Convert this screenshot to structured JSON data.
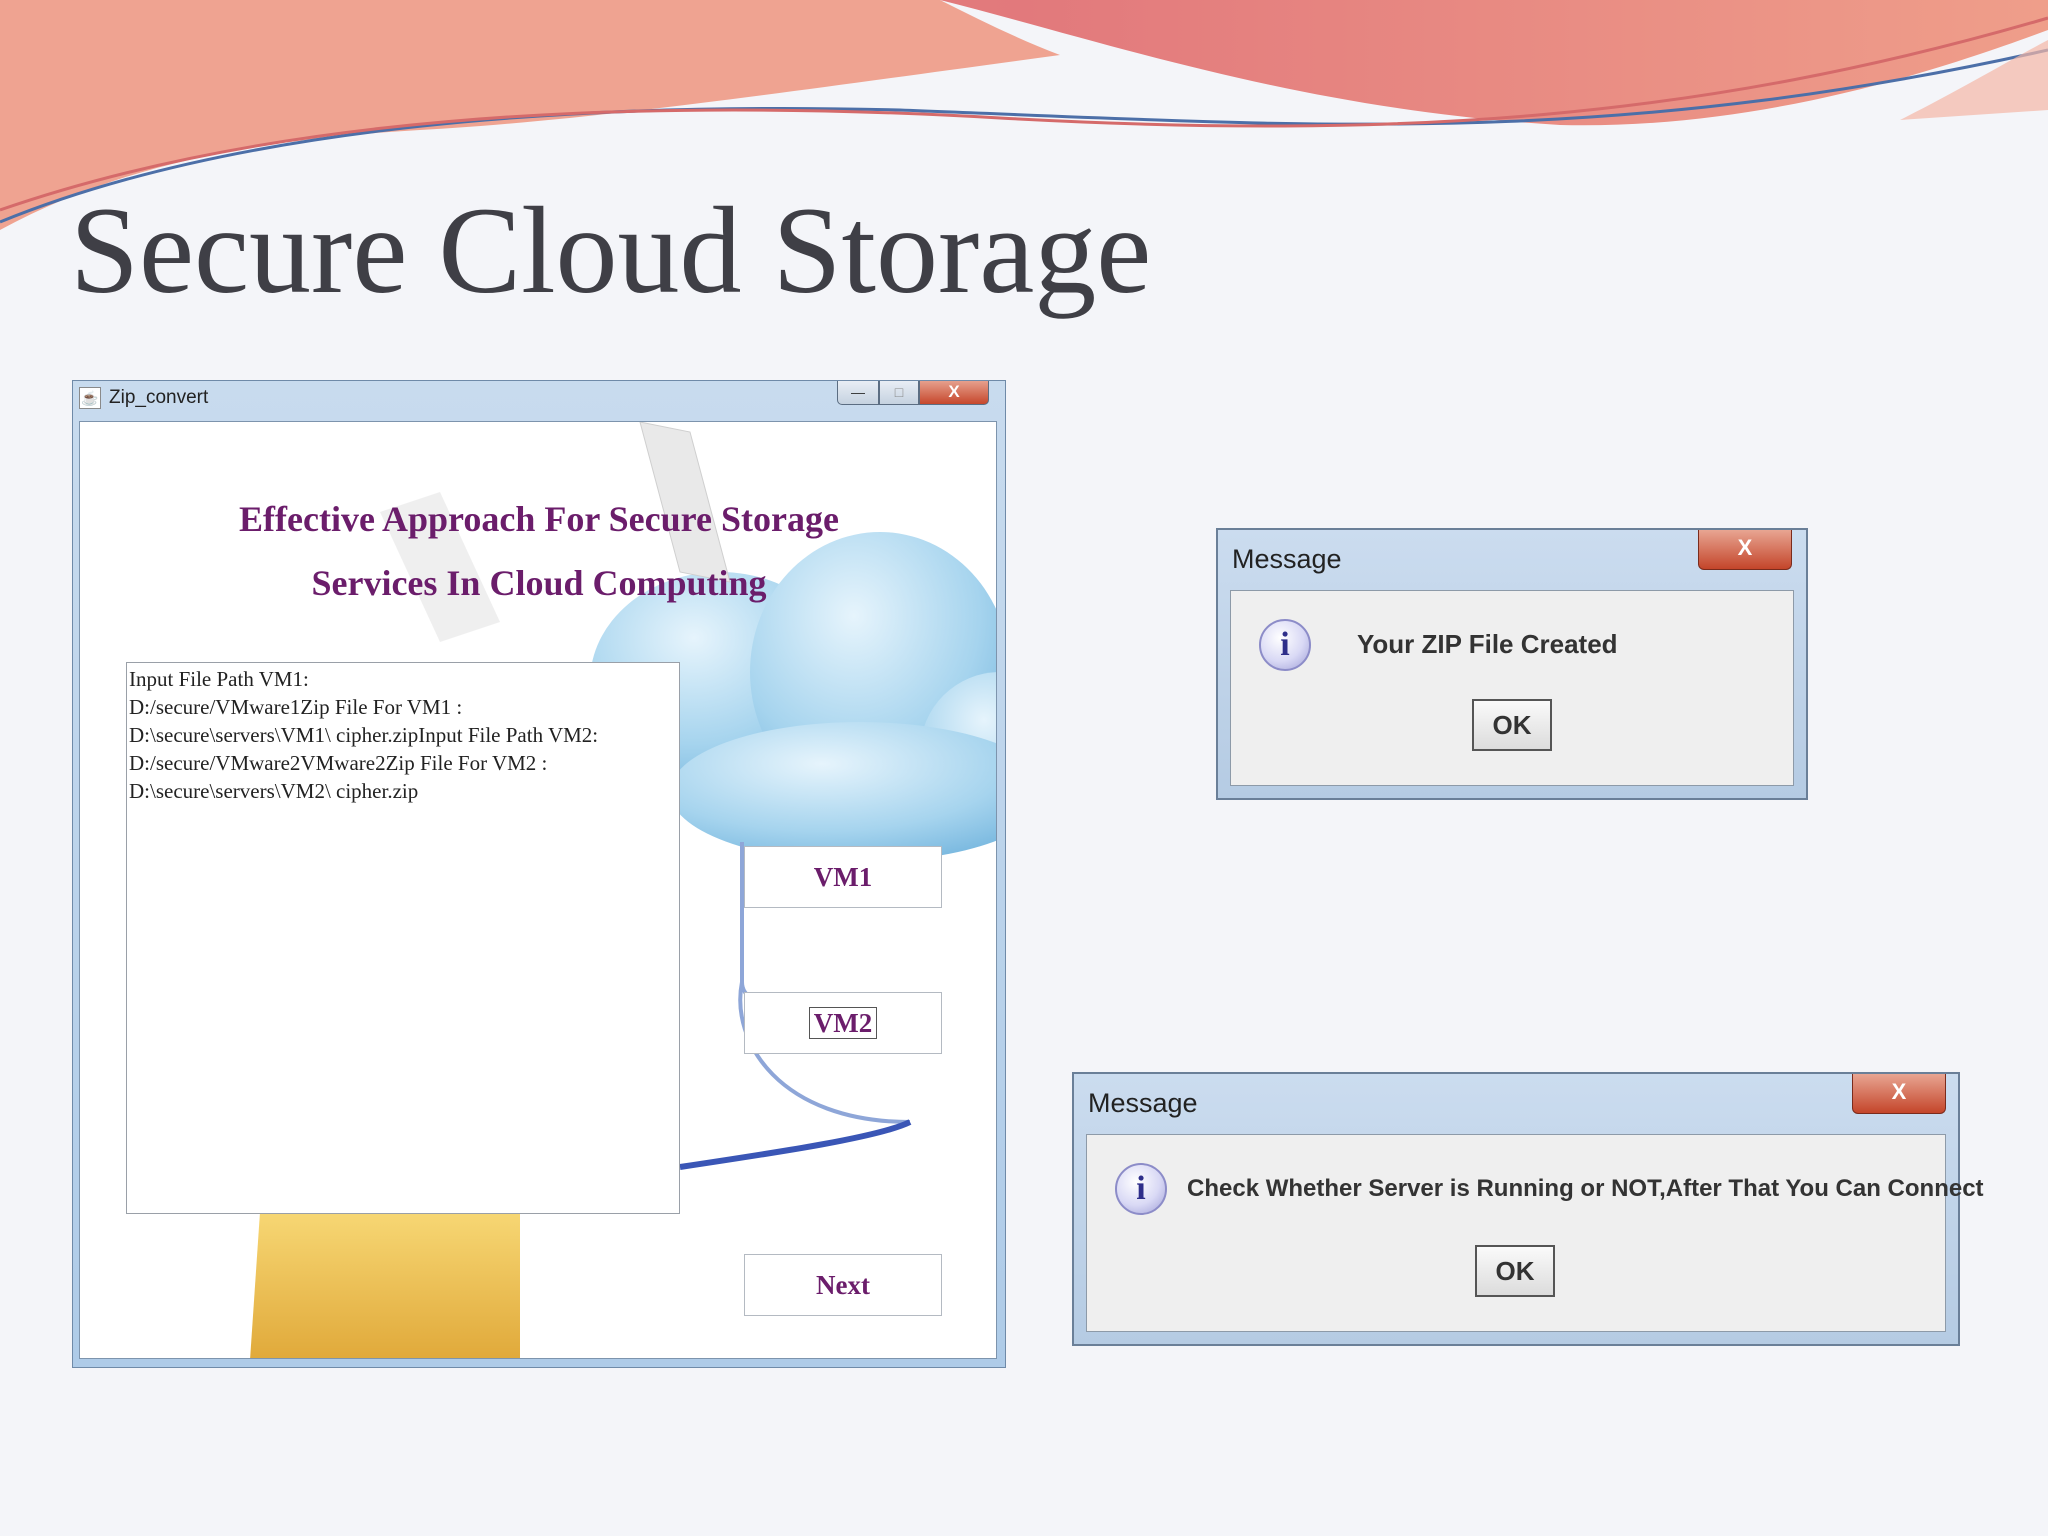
{
  "slide": {
    "title": "Secure Cloud Storage"
  },
  "app_window": {
    "title": "Zip_convert",
    "controls": {
      "minimize": "—",
      "maximize": "□",
      "close": "X"
    },
    "heading_line1": "Effective Approach For Secure Storage",
    "heading_line2": "Services  In Cloud Computing",
    "log_text": "Input File Path VM1:\nD:/secure/VMware1Zip File For VM1 :\nD:\\secure\\servers\\VM1\\ cipher.zipInput File Path VM2:\nD:/secure/VMware2VMware2Zip File For VM2 :\nD:\\secure\\servers\\VM2\\ cipher.zip",
    "buttons": {
      "vm1": "VM1",
      "vm2": "VM2",
      "next": "Next"
    }
  },
  "dialog_zip": {
    "title": "Message",
    "close": "X",
    "icon_glyph": "i",
    "message": "Your ZIP File Created",
    "ok": "OK"
  },
  "dialog_server": {
    "title": "Message",
    "close": "X",
    "icon_glyph": "i",
    "message": "Check Whether Server is Running or NOT,After That You Can Connect",
    "ok": "OK"
  },
  "colors": {
    "heading": "#6b1d6b",
    "title_text": "#3f3f46",
    "wave_primary": "#e8846f",
    "wave_light": "#f6c4b4",
    "cloud": "#8fc6e6"
  },
  "icons": {
    "app": "java-cup-icon",
    "info": "info-icon",
    "close": "close-icon"
  }
}
